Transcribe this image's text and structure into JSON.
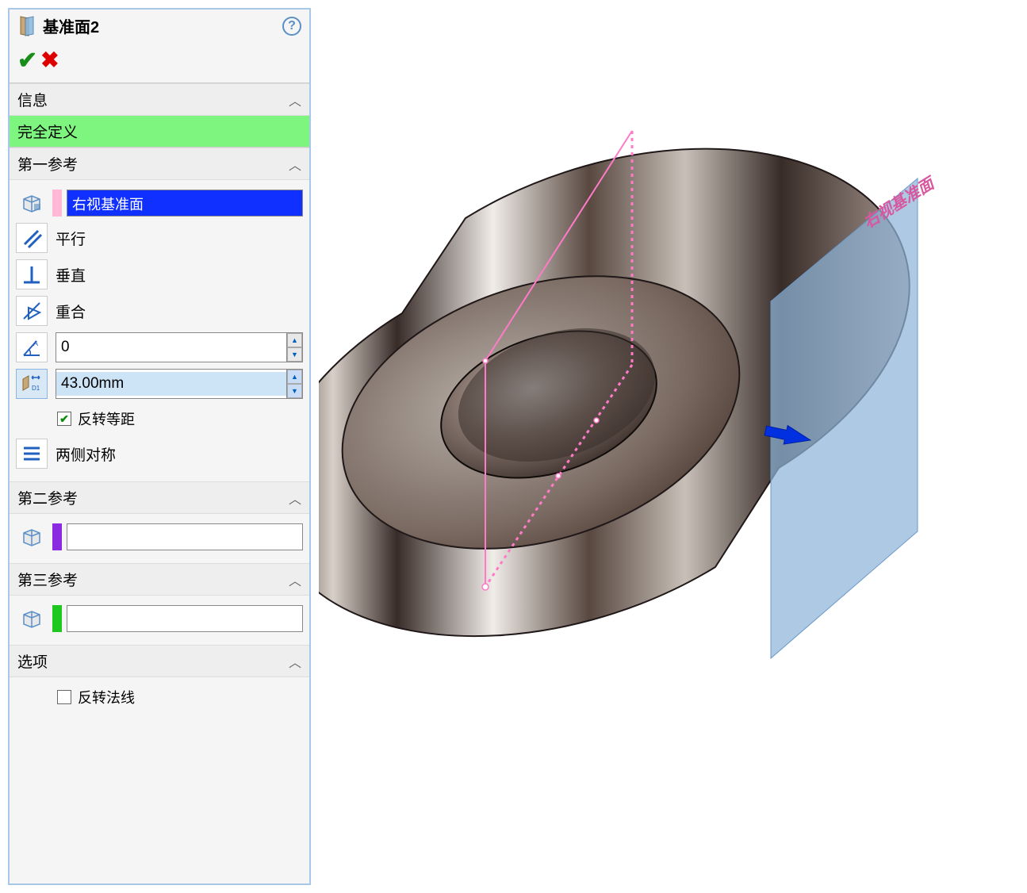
{
  "header": {
    "title": "基准面2"
  },
  "info_section": {
    "label": "信息",
    "status": "完全定义"
  },
  "ref1": {
    "label": "第一参考",
    "selected_value": "右视基准面",
    "parallel": "平行",
    "perpendicular": "垂直",
    "coincident": "重合",
    "angle_value": "0",
    "distance_value": "43.00mm",
    "flip_offset": "反转等距",
    "mid_plane": "两侧对称"
  },
  "ref2": {
    "label": "第二参考"
  },
  "ref3": {
    "label": "第三参考"
  },
  "options": {
    "label": "选项",
    "flip_normal": "反转法线"
  },
  "viewport": {
    "plane_label": "右视基准面"
  }
}
